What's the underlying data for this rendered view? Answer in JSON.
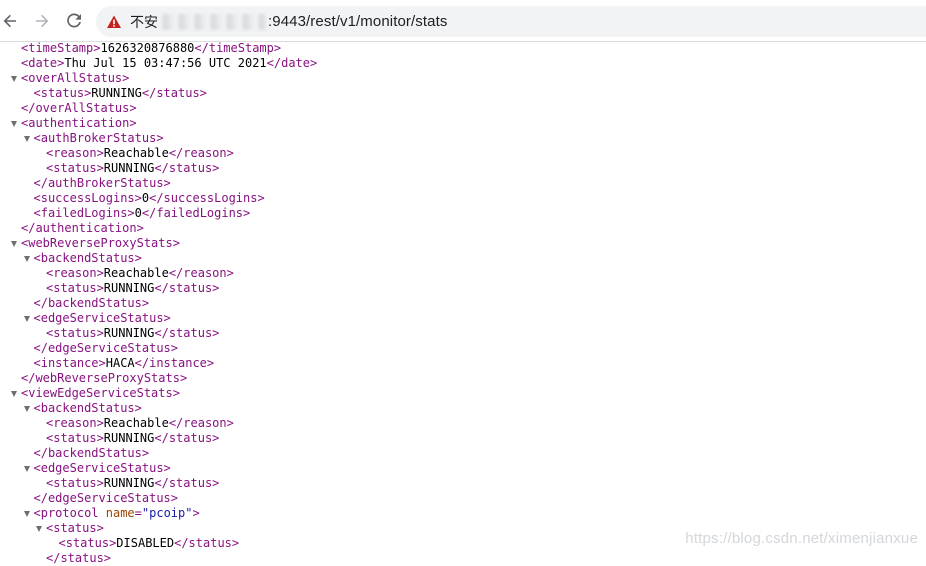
{
  "browser": {
    "security_text": "不安",
    "url_text": ":9443/rest/v1/monitor/stats",
    "icons": {
      "back": "back-arrow-icon",
      "forward": "forward-arrow-icon",
      "reload": "reload-icon",
      "warning": "warning-triangle-icon"
    },
    "colors": {
      "warning": "#c5221f",
      "toolbar_bg": "#ffffff",
      "omnibox_bg": "#f1f3f4"
    }
  },
  "xml_tree": {
    "lines": [
      {
        "text": "<timeStamp>1626320876880</timeStamp>",
        "indent": 1,
        "toggle": false
      },
      {
        "text": "<date>Thu Jul 15 03:47:56 UTC 2021</date>",
        "indent": 1,
        "toggle": false
      },
      {
        "text": "<overAllStatus>",
        "indent": 0,
        "toggle": true
      },
      {
        "text": "<status>RUNNING</status>",
        "indent": 2,
        "toggle": false
      },
      {
        "text": "</overAllStatus>",
        "indent": 1,
        "toggle": false
      },
      {
        "text": "<authentication>",
        "indent": 0,
        "toggle": true
      },
      {
        "text": "<authBrokerStatus>",
        "indent": 1,
        "toggle": true
      },
      {
        "text": "<reason>Reachable</reason>",
        "indent": 3,
        "toggle": false
      },
      {
        "text": "<status>RUNNING</status>",
        "indent": 3,
        "toggle": false
      },
      {
        "text": "</authBrokerStatus>",
        "indent": 2,
        "toggle": false
      },
      {
        "text": "<successLogins>0</successLogins>",
        "indent": 2,
        "toggle": false
      },
      {
        "text": "<failedLogins>0</failedLogins>",
        "indent": 2,
        "toggle": false
      },
      {
        "text": "</authentication>",
        "indent": 1,
        "toggle": false
      },
      {
        "text": "<webReverseProxyStats>",
        "indent": 0,
        "toggle": true
      },
      {
        "text": "<backendStatus>",
        "indent": 1,
        "toggle": true
      },
      {
        "text": "<reason>Reachable</reason>",
        "indent": 3,
        "toggle": false
      },
      {
        "text": "<status>RUNNING</status>",
        "indent": 3,
        "toggle": false
      },
      {
        "text": "</backendStatus>",
        "indent": 2,
        "toggle": false
      },
      {
        "text": "<edgeServiceStatus>",
        "indent": 1,
        "toggle": true
      },
      {
        "text": "<status>RUNNING</status>",
        "indent": 3,
        "toggle": false
      },
      {
        "text": "</edgeServiceStatus>",
        "indent": 2,
        "toggle": false
      },
      {
        "text": "<instance>HACA</instance>",
        "indent": 2,
        "toggle": false
      },
      {
        "text": "</webReverseProxyStats>",
        "indent": 1,
        "toggle": false
      },
      {
        "text": "<viewEdgeServiceStats>",
        "indent": 0,
        "toggle": true
      },
      {
        "text": "<backendStatus>",
        "indent": 1,
        "toggle": true
      },
      {
        "text": "<reason>Reachable</reason>",
        "indent": 3,
        "toggle": false
      },
      {
        "text": "<status>RUNNING</status>",
        "indent": 3,
        "toggle": false
      },
      {
        "text": "</backendStatus>",
        "indent": 2,
        "toggle": false
      },
      {
        "text": "<edgeServiceStatus>",
        "indent": 1,
        "toggle": true
      },
      {
        "text": "<status>RUNNING</status>",
        "indent": 3,
        "toggle": false
      },
      {
        "text": "</edgeServiceStatus>",
        "indent": 2,
        "toggle": false
      },
      {
        "text": "<protocol name=\"pcoip\">",
        "indent": 1,
        "toggle": true
      },
      {
        "text": "<status>",
        "indent": 2,
        "toggle": true
      },
      {
        "text": "<status>DISABLED</status>",
        "indent": 4,
        "toggle": false
      },
      {
        "text": "</status>",
        "indent": 3,
        "toggle": false
      }
    ]
  },
  "watermark": "https://blog.csdn.net/ximenjianxue"
}
